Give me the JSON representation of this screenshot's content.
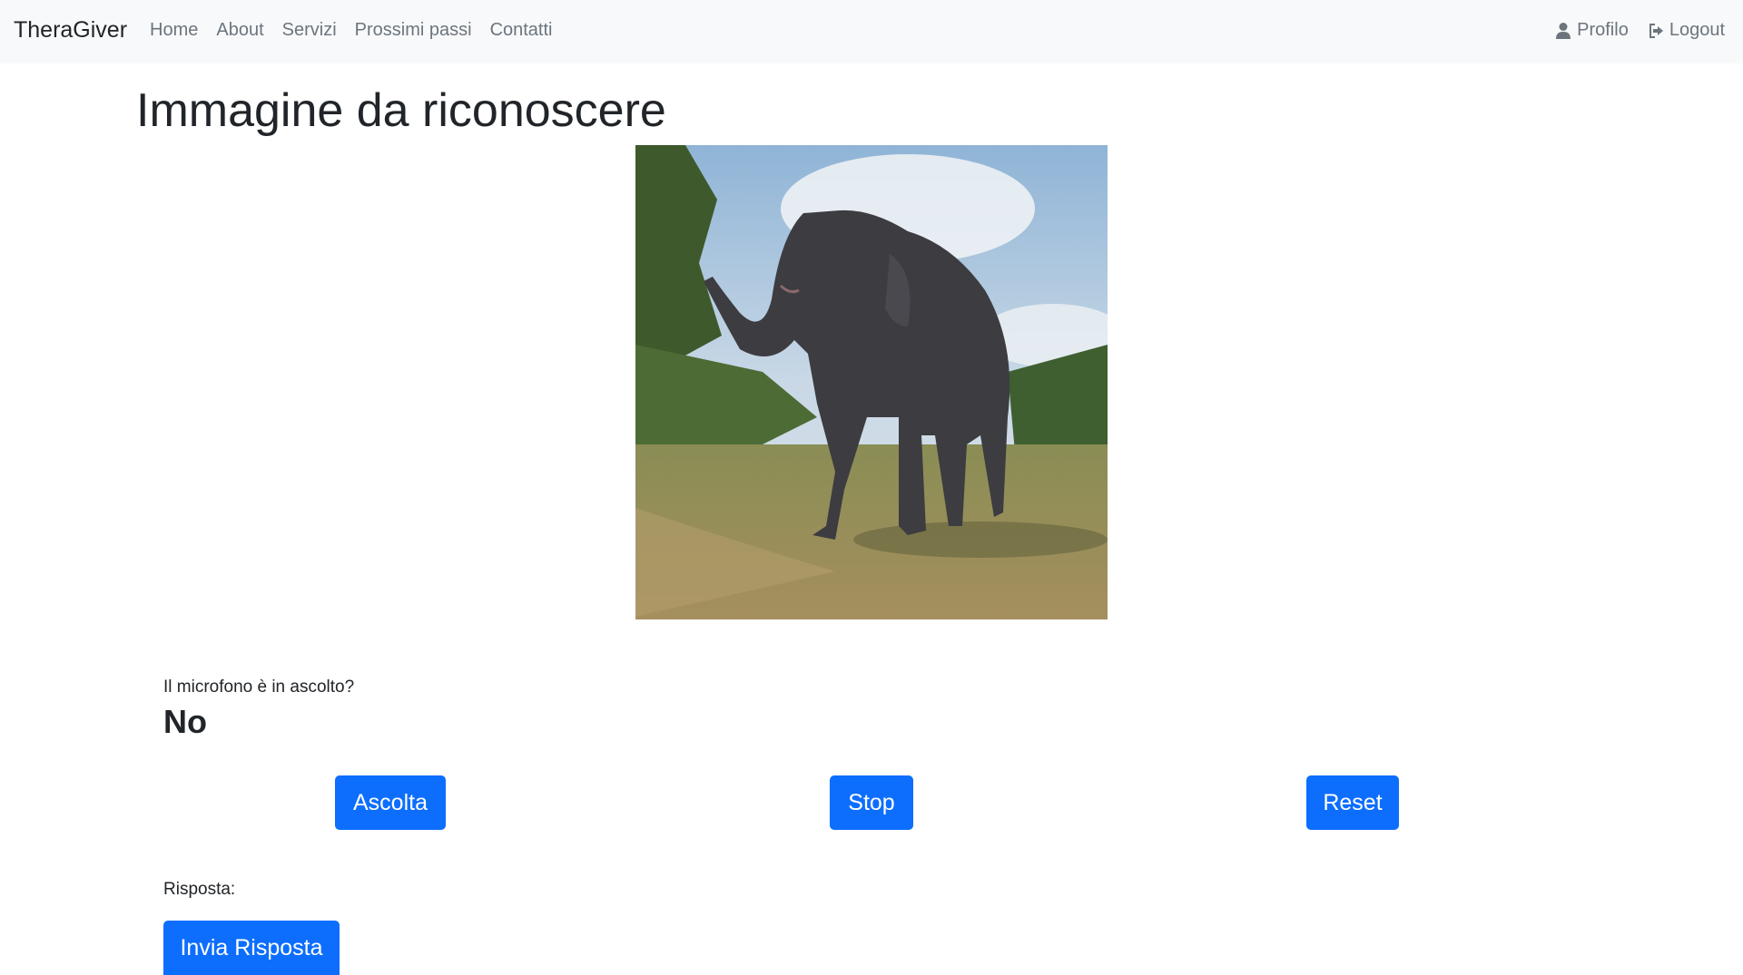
{
  "navbar": {
    "brand": "TheraGiver",
    "links": [
      "Home",
      "About",
      "Servizi",
      "Prossimi passi",
      "Contatti"
    ],
    "profile_label": "Profilo",
    "profile_icon": "user-icon",
    "logout_label": "Logout",
    "logout_icon": "sign-out-icon",
    "background": "#f8f9fa",
    "link_color": "#6c757d"
  },
  "main": {
    "title": "Immagine da riconoscere",
    "mic_label": "Il microfono è in ascolto?",
    "mic_status": "No",
    "buttons": {
      "listen": "Ascolta",
      "stop": "Stop",
      "reset": "Reset"
    },
    "answer_label": "Risposta:",
    "submit_label": "Invia Risposta",
    "accent_color": "#0d6efd"
  }
}
